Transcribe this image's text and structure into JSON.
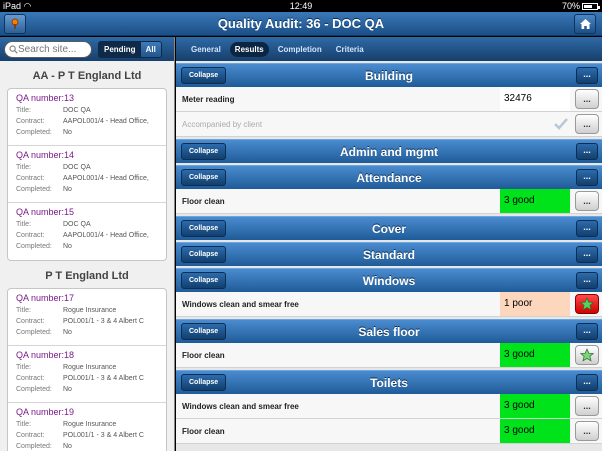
{
  "status_bar": {
    "carrier": "iPad",
    "time": "12:49",
    "battery": "70%",
    "battery_level": 0.7
  },
  "header": {
    "title": "Quality Audit: 36 - DOC QA"
  },
  "sidebar": {
    "search_placeholder": "Search site...",
    "filters": [
      "Pending",
      "All"
    ],
    "groups": [
      {
        "title": "AA - P T England Ltd",
        "items": [
          {
            "qa": "QA number:13",
            "title": "DOC QA",
            "contract": "AAPOL001/4 - Head Office,",
            "completed": "No"
          },
          {
            "qa": "QA number:14",
            "title": "DOC QA",
            "contract": "AAPOL001/4 - Head Office,",
            "completed": "No"
          },
          {
            "qa": "QA number:15",
            "title": "DOC QA",
            "contract": "AAPOL001/4 - Head Office,",
            "completed": "No"
          }
        ]
      },
      {
        "title": "P T England Ltd",
        "items": [
          {
            "qa": "QA number:17",
            "title": "Rogue Insurance",
            "contract": "POL001/1 - 3 & 4 Albert C",
            "completed": "No"
          },
          {
            "qa": "QA number:18",
            "title": "Rogue Insurance",
            "contract": "POL001/1 - 3 & 4 Albert C",
            "completed": "No"
          },
          {
            "qa": "QA number:19",
            "title": "Rogue Insurance",
            "contract": "POL001/1 - 3 & 4 Albert C",
            "completed": "No"
          }
        ]
      }
    ],
    "labels": {
      "title": "Title:",
      "contract": "Contract:",
      "completed": "Completed:"
    }
  },
  "tabs": [
    "General",
    "Results",
    "Completion",
    "Criteria"
  ],
  "collapse_label": "Collapse",
  "more_label": "...",
  "sections": [
    {
      "title": "Building",
      "rows": [
        {
          "question": "Meter reading",
          "value": "32476",
          "style": "plain",
          "button": "more"
        },
        {
          "question": "Accompanied by client",
          "value": "",
          "style": "check",
          "button": "more"
        }
      ]
    },
    {
      "title": "Admin and mgmt",
      "rows": []
    },
    {
      "title": "Attendance",
      "rows": [
        {
          "question": "Floor clean",
          "value": "3 good",
          "style": "good",
          "button": "more"
        }
      ]
    },
    {
      "title": "Cover",
      "rows": []
    },
    {
      "title": "Standard",
      "rows": []
    },
    {
      "title": "Windows",
      "rows": [
        {
          "question": "Windows clean and smear free",
          "value": "1 poor",
          "style": "poor",
          "button": "star-red"
        }
      ]
    },
    {
      "title": "Sales floor",
      "rows": [
        {
          "question": "Floor clean",
          "value": "3 good",
          "style": "good",
          "button": "star"
        }
      ]
    },
    {
      "title": "Toilets",
      "rows": [
        {
          "question": "Windows clean and smear free",
          "value": "3 good",
          "style": "good",
          "button": "more"
        },
        {
          "question": "Floor clean",
          "value": "3 good",
          "style": "good",
          "button": "more"
        }
      ]
    }
  ],
  "colors": {
    "accent": "#1f5b98",
    "good": "#00e21a",
    "poor": "#fcd7bd",
    "qa_link": "#7a1a8a"
  }
}
